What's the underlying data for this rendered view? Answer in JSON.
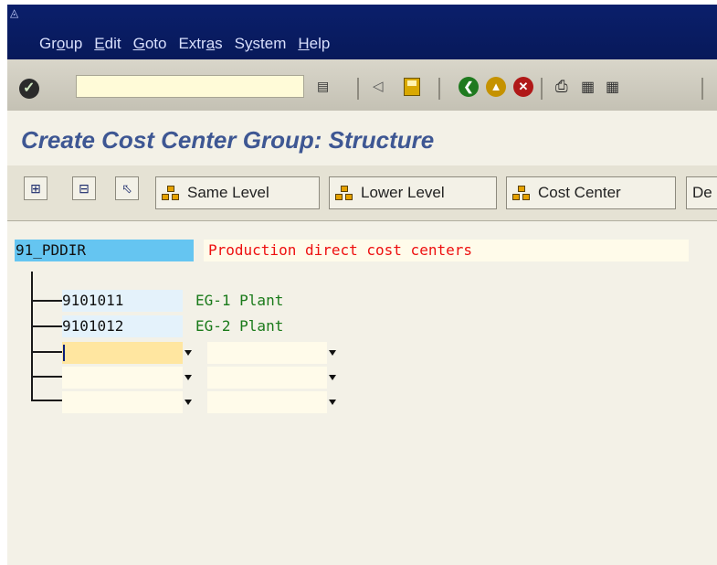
{
  "menu": {
    "items": [
      {
        "pre": "Gr",
        "u": "o",
        "post": "up"
      },
      {
        "pre": "",
        "u": "E",
        "post": "dit"
      },
      {
        "pre": "",
        "u": "G",
        "post": "oto"
      },
      {
        "pre": "Extr",
        "u": "a",
        "post": "s"
      },
      {
        "pre": "S",
        "u": "y",
        "post": "stem"
      },
      {
        "pre": "",
        "u": "H",
        "post": "elp"
      }
    ]
  },
  "toolbar": {
    "command_value": "",
    "icons": [
      "enter-icon",
      "command-history-icon",
      "back-arrow-icon",
      "save-icon",
      "back-icon",
      "exit-icon",
      "cancel-icon",
      "print-icon",
      "find-icon",
      "find-next-icon"
    ]
  },
  "page": {
    "title": "Create Cost Center Group: Structure"
  },
  "app_toolbar": {
    "buttons": [
      {
        "icon": "expand-subtree-icon"
      },
      {
        "icon": "collapse-subtree-icon"
      },
      {
        "icon": "select-icon"
      },
      {
        "icon": "hierarchy-icon",
        "label": "Same Level"
      },
      {
        "icon": "hierarchy-icon",
        "label": "Lower Level"
      },
      {
        "icon": "hierarchy-icon",
        "label": "Cost Center"
      },
      {
        "label": "De"
      }
    ]
  },
  "tree": {
    "root": {
      "id": "91_PDDIR",
      "description": "Production direct cost centers"
    },
    "cost_centers": [
      {
        "id": "9101011",
        "name": "EG-1 Plant"
      },
      {
        "id": "9101012",
        "name": "EG-2 Plant"
      }
    ],
    "empty_rows": [
      {
        "id": "",
        "description": "",
        "focused": true
      },
      {
        "id": "",
        "description": "",
        "focused": false
      },
      {
        "id": "",
        "description": "",
        "focused": false
      }
    ]
  },
  "colors": {
    "menubar_bg": "#0a1f6b",
    "title_color": "#3e5793",
    "root_highlight": "#65c5f1",
    "description_red": "#ee1010",
    "cc_name_green": "#1a7a1a"
  }
}
